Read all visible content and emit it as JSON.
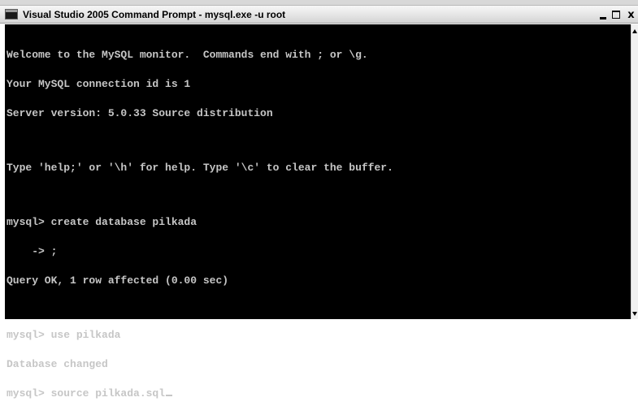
{
  "window": {
    "title": "Visual Studio 2005 Command Prompt - mysql.exe -u root",
    "controls": {
      "minimize_icon": "minimize-icon",
      "maximize_icon": "maximize-icon",
      "close_label": "x"
    }
  },
  "console": {
    "text_color": "#c6c6c6",
    "background_color": "#000000",
    "lines": [
      "Welcome to the MySQL monitor.  Commands end with ; or \\g.",
      "Your MySQL connection id is 1",
      "Server version: 5.0.33 Source distribution",
      "",
      "Type 'help;' or '\\h' for help. Type '\\c' to clear the buffer.",
      "",
      "mysql> create database pilkada",
      "    -> ;",
      "Query OK, 1 row affected (0.00 sec)",
      "",
      "mysql> use pilkada",
      "Database changed",
      "mysql> source pilkada.sql"
    ]
  }
}
